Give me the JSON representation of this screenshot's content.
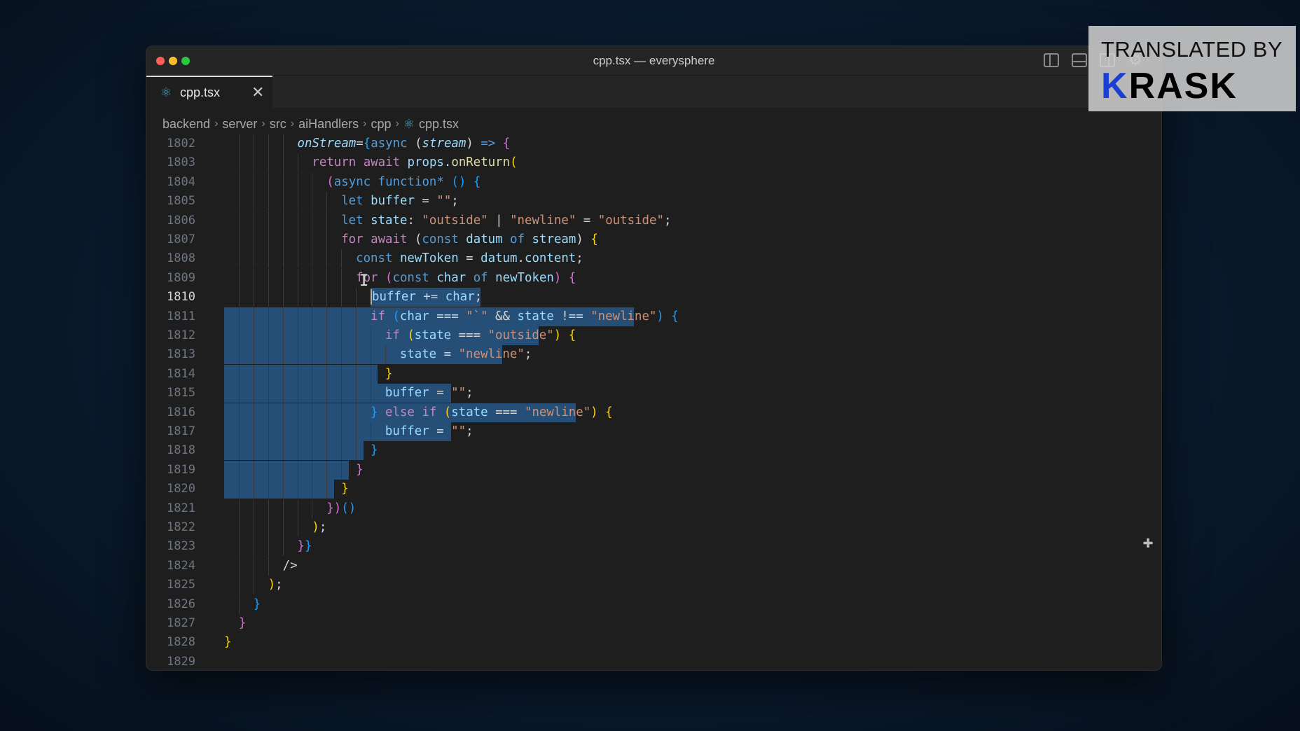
{
  "window": {
    "title": "cpp.tsx — everysphere"
  },
  "tab": {
    "icon": "react-icon",
    "label": "cpp.tsx",
    "close": "✕"
  },
  "breadcrumb": {
    "items": [
      "backend",
      "server",
      "src",
      "aiHandlers",
      "cpp"
    ],
    "file": "cpp.tsx",
    "separator": "›"
  },
  "editor": {
    "active_line": "1810",
    "lines": [
      {
        "n": "1802"
      },
      {
        "n": "1803"
      },
      {
        "n": "1804"
      },
      {
        "n": "1805"
      },
      {
        "n": "1806"
      },
      {
        "n": "1807"
      },
      {
        "n": "1808"
      },
      {
        "n": "1809"
      },
      {
        "n": "1810"
      },
      {
        "n": "1811"
      },
      {
        "n": "1812"
      },
      {
        "n": "1813"
      },
      {
        "n": "1814"
      },
      {
        "n": "1815"
      },
      {
        "n": "1816"
      },
      {
        "n": "1817"
      },
      {
        "n": "1818"
      },
      {
        "n": "1819"
      },
      {
        "n": "1820"
      },
      {
        "n": "1821"
      },
      {
        "n": "1822"
      },
      {
        "n": "1823"
      },
      {
        "n": "1824"
      },
      {
        "n": "1825"
      },
      {
        "n": "1826"
      },
      {
        "n": "1827"
      },
      {
        "n": "1828"
      },
      {
        "n": "1829"
      }
    ],
    "code": {
      "l1802": [
        "onStream",
        "=",
        "{",
        "async",
        " (",
        "stream",
        ") ",
        "=>",
        " {"
      ],
      "l1803": [
        "return",
        " ",
        "await",
        " props.",
        "onReturn",
        "("
      ],
      "l1804": [
        "(",
        "async",
        " ",
        "function",
        "*",
        " () ",
        "{"
      ],
      "l1805": [
        "let",
        " ",
        "buffer",
        " = ",
        "\"\"",
        ";"
      ],
      "l1806": [
        "let",
        " ",
        "state",
        ": ",
        "\"outside\"",
        " | ",
        "\"newline\"",
        " = ",
        "\"outside\"",
        ";"
      ],
      "l1807": [
        "for",
        " ",
        "await",
        " (",
        "const",
        " ",
        "datum",
        " ",
        "of",
        " ",
        "stream",
        ") ",
        "{"
      ],
      "l1808": [
        "const",
        " ",
        "newToken",
        " = ",
        "datum",
        ".",
        "content",
        ";"
      ],
      "l1809": [
        "for",
        " (",
        "const",
        " ",
        "char",
        " ",
        "of",
        " ",
        "newToken",
        ") ",
        "{"
      ],
      "l1810": [
        "buffer",
        " += ",
        "char",
        ";"
      ],
      "l1811": [
        "if",
        " (",
        "char",
        " === ",
        "\"`\"",
        " && ",
        "state",
        " !== ",
        "\"newline\"",
        ") ",
        "{"
      ],
      "l1812": [
        "if",
        " (",
        "state",
        " === ",
        "\"outside\"",
        ") ",
        "{"
      ],
      "l1813": [
        "state",
        " = ",
        "\"newline\"",
        ";"
      ],
      "l1814": [
        "}"
      ],
      "l1815": [
        "buffer",
        " = ",
        "\"\"",
        ";"
      ],
      "l1816": [
        "}",
        " ",
        "else",
        " ",
        "if",
        " (",
        "state",
        " === ",
        "\"newline\"",
        ") ",
        "{"
      ],
      "l1817": [
        "buffer",
        " = ",
        "\"\"",
        ";"
      ],
      "l1818": [
        "}"
      ],
      "l1819": [
        "}"
      ],
      "l1820": [
        "}"
      ],
      "l1821": [
        "}",
        ")",
        "()"
      ],
      "l1822": [
        ")",
        ";"
      ],
      "l1823": [
        "}",
        "}"
      ],
      "l1824": [
        "/>"
      ],
      "l1825": [
        ")",
        ";"
      ],
      "l1826": [
        "}"
      ],
      "l1827": [
        "}"
      ],
      "l1828": [
        "}"
      ]
    }
  },
  "watermark": {
    "top": "TRANSLATED BY",
    "logo_k": "K",
    "logo_rest": "RASK"
  },
  "colors": {
    "selection": "#264f78",
    "editor_bg": "#1e1e1e",
    "keyword": "#c586c0",
    "string": "#ce9178",
    "variable": "#9cdcfe",
    "function": "#dcdcaa"
  }
}
